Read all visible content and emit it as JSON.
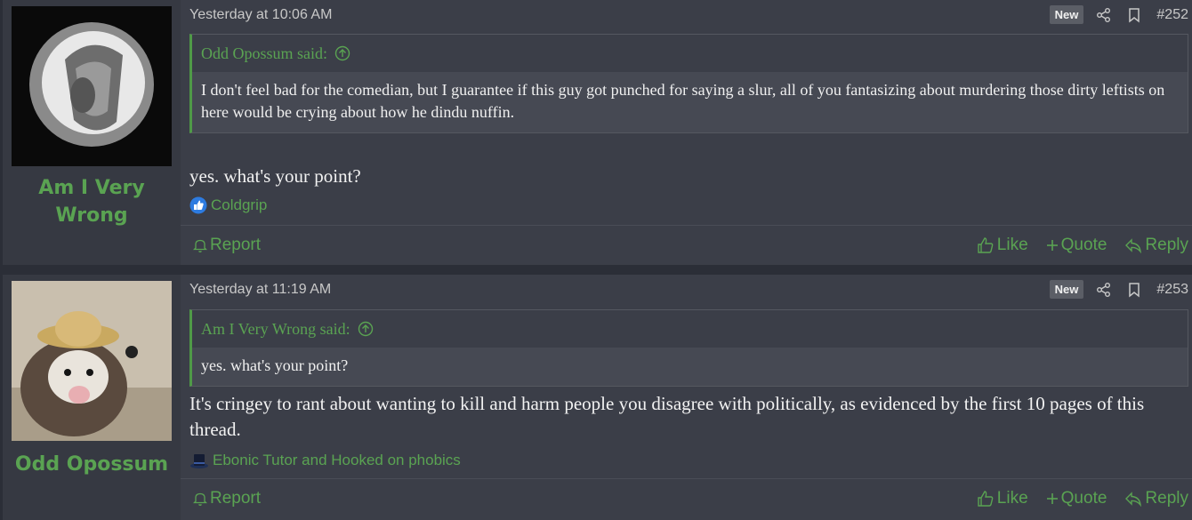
{
  "posts": [
    {
      "author": "Am I Very Wrong",
      "date": "Yesterday at 10:06 AM",
      "badge": "New",
      "number": "#252",
      "quote": {
        "author_said": "Odd Opossum said:",
        "text": "I don't feel bad for the comedian, but I guarantee if this guy got punched for saying a slur, all of you fantasizing about murdering those dirty leftists on here would be crying about how he dindu nuffin."
      },
      "message": "yes. what's your point?",
      "reactions": "Coldgrip",
      "actions": {
        "report": "Report",
        "like": "Like",
        "quote": "Quote",
        "reply": "Reply"
      }
    },
    {
      "author": "Odd Opossum",
      "date": "Yesterday at 11:19 AM",
      "badge": "New",
      "number": "#253",
      "quote": {
        "author_said": "Am I Very Wrong said:",
        "text": "yes. what's your point?"
      },
      "message": "It's cringey to rant about wanting to kill and harm people you disagree with politically, as evidenced by the first 10 pages of this thread.",
      "reactions": "Ebonic Tutor and Hooked on phobics",
      "actions": {
        "report": "Report",
        "like": "Like",
        "quote": "Quote",
        "reply": "Reply"
      }
    }
  ],
  "colors": {
    "accent": "#5aa352",
    "background": "#3b3e48",
    "sidebar": "#363942"
  },
  "icons": [
    "share-icon",
    "bookmark-icon",
    "up-arrow-icon",
    "like-reaction-icon",
    "hat-reaction-icon",
    "bell-icon",
    "thumbs-up-icon",
    "plus-icon",
    "reply-icon"
  ]
}
